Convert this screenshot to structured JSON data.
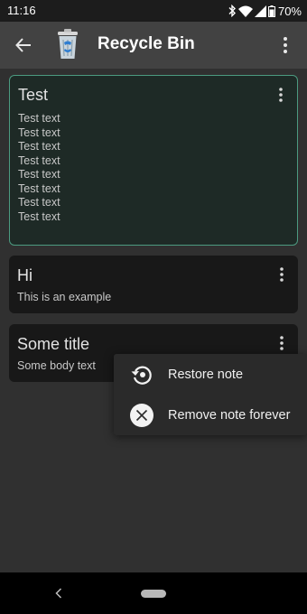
{
  "status_bar": {
    "time": "11:16",
    "battery": "70%"
  },
  "app_bar": {
    "title": "Recycle Bin",
    "back_icon": "arrow-back-icon",
    "app_icon": "recycle-bin-icon",
    "overflow_icon": "more-vert-icon"
  },
  "notes": [
    {
      "title": "Test",
      "body": "Test text\nTest text\nTest text\nTest text\nTest text\nTest text\nTest text\nTest text",
      "selected": true
    },
    {
      "title": "Hi",
      "body": "This is an example",
      "selected": false
    },
    {
      "title": "Some title",
      "body": "Some body text",
      "selected": false
    }
  ],
  "context_menu": {
    "items": [
      {
        "label": "Restore note",
        "icon": "restore-icon"
      },
      {
        "label": "Remove note forever",
        "icon": "remove-forever-icon"
      }
    ]
  },
  "colors": {
    "selected_border": "#4c9a80",
    "app_bar": "#424242",
    "background": "#303030"
  }
}
